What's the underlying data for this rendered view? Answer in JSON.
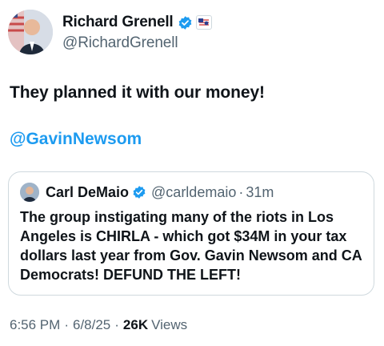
{
  "author": {
    "display_name": "Richard Grenell",
    "handle": "@RichardGrenell",
    "verified_icon": "verified-badge-icon",
    "affiliation_icon": "affiliation-badge-icon"
  },
  "tweet": {
    "text": "They planned it with our money!",
    "mention": "@GavinNewsom"
  },
  "quote": {
    "display_name": "Carl DeMaio",
    "handle": "@carldemaio",
    "separator": "·",
    "time": "31m",
    "text": "The group instigating many of the riots in Los Angeles is CHIRLA - which got $34M in your tax dollars last year from Gov. Gavin Newsom and CA Democrats! DEFUND THE LEFT!"
  },
  "meta": {
    "time": "6:56 PM",
    "date": "6/8/25",
    "separator": "·",
    "views_count": "26K",
    "views_label": "Views"
  },
  "colors": {
    "link": "#1d9bf0",
    "verified": "#1d9bf0",
    "secondary_text": "#536471",
    "border": "#cfd9de"
  }
}
